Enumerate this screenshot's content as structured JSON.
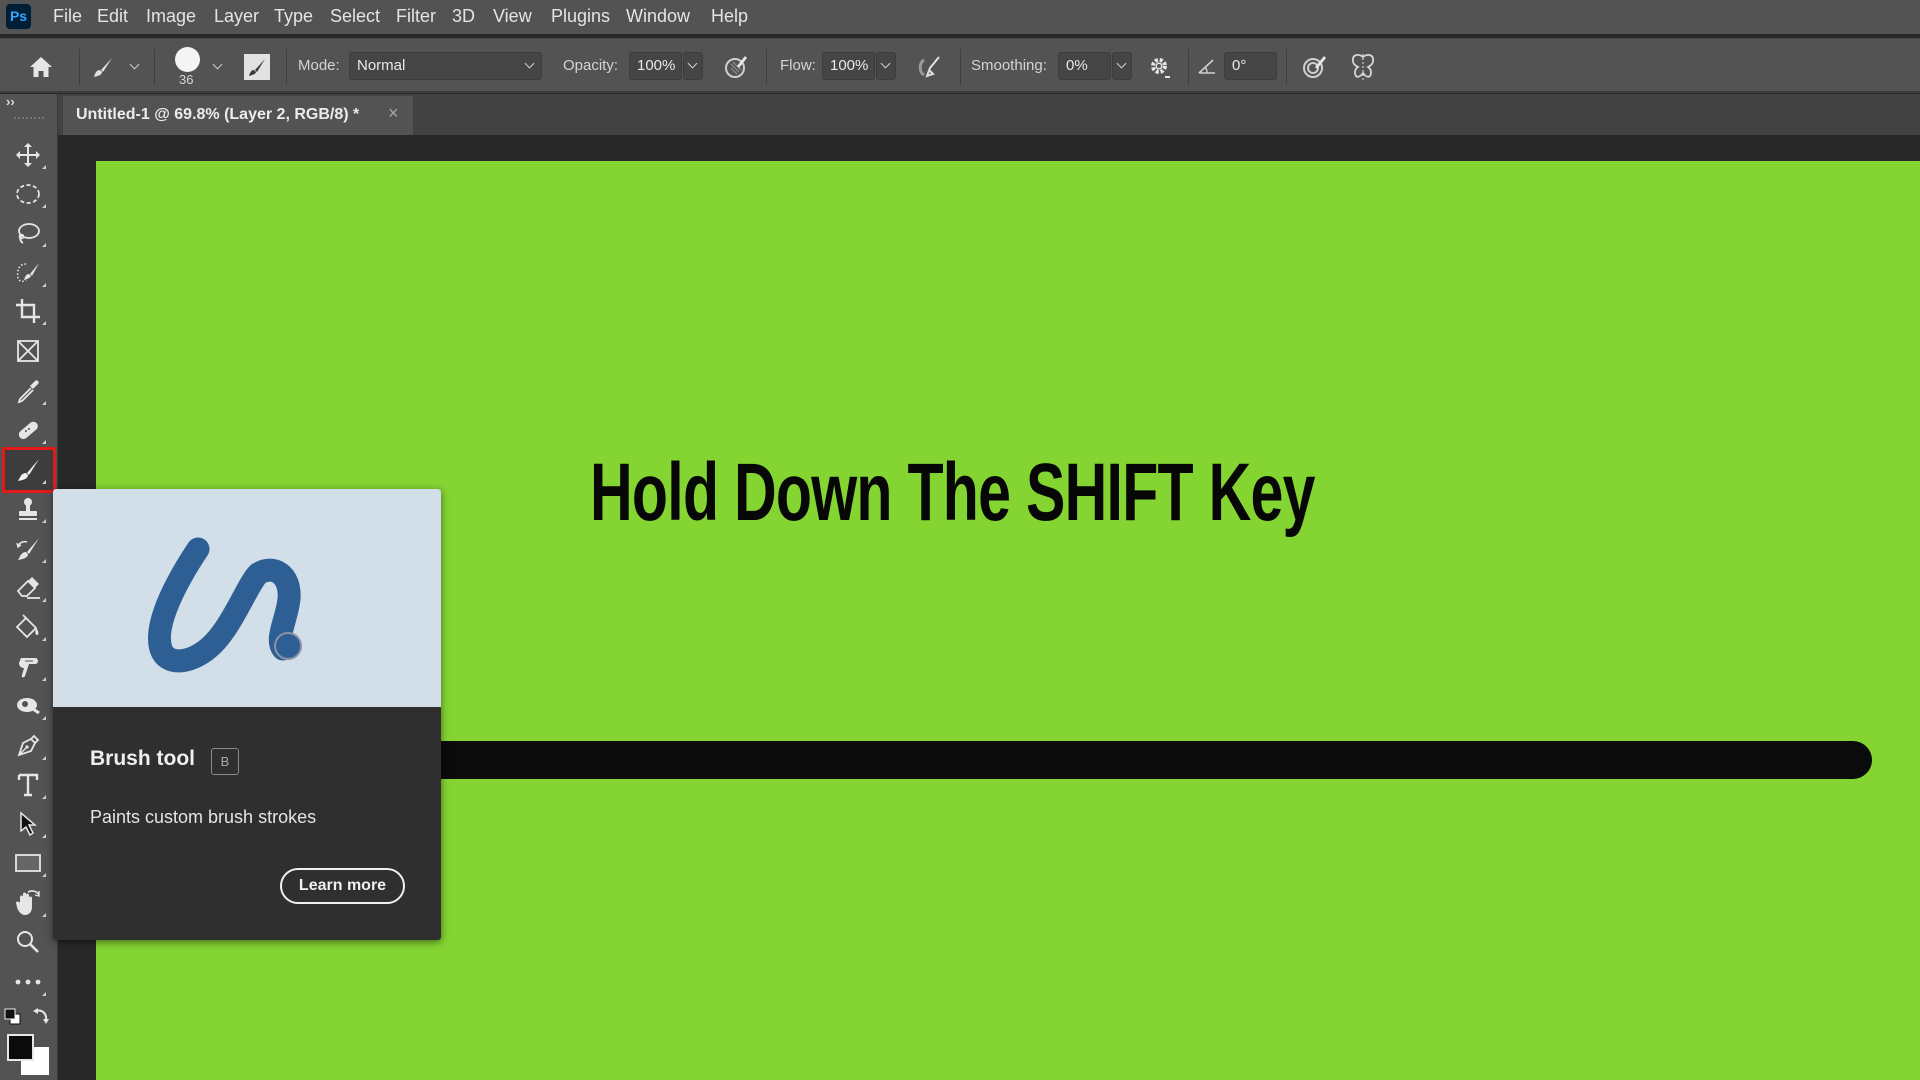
{
  "app": {
    "logo": "Ps",
    "menu": [
      "File",
      "Edit",
      "Image",
      "Layer",
      "Type",
      "Select",
      "Filter",
      "3D",
      "View",
      "Plugins",
      "Window",
      "Help"
    ]
  },
  "options_bar": {
    "brush_size": "36",
    "mode_label": "Mode:",
    "mode_value": "Normal",
    "opacity_label": "Opacity:",
    "opacity_value": "100%",
    "flow_label": "Flow:",
    "flow_value": "100%",
    "smoothing_label": "Smoothing:",
    "smoothing_value": "0%",
    "angle_value": "0°",
    "icons": [
      "home-icon",
      "brush-preset-icon",
      "brush-tip-icon",
      "brush-settings-panel-icon",
      "pressure-opacity-icon",
      "airbrush-icon",
      "smoothing-settings-icon",
      "angle-icon",
      "pressure-size-icon",
      "symmetry-icon"
    ]
  },
  "document_tab": {
    "title": "Untitled-1 @ 69.8% (Layer 2, RGB/8) *",
    "close": "×"
  },
  "toolbar": {
    "collapse": "››",
    "tools": [
      {
        "name": "move-tool",
        "icon": "move-icon"
      },
      {
        "name": "marquee-tool",
        "icon": "elliptical-marquee-icon"
      },
      {
        "name": "lasso-tool",
        "icon": "lasso-icon"
      },
      {
        "name": "quick-selection-tool",
        "icon": "quick-selection-icon"
      },
      {
        "name": "crop-tool",
        "icon": "crop-icon"
      },
      {
        "name": "frame-tool",
        "icon": "frame-icon"
      },
      {
        "name": "eyedropper-tool",
        "icon": "eyedropper-icon"
      },
      {
        "name": "healing-brush-tool",
        "icon": "bandage-icon"
      },
      {
        "name": "brush-tool",
        "icon": "brush-icon",
        "selected": true
      },
      {
        "name": "clone-stamp-tool",
        "icon": "stamp-icon"
      },
      {
        "name": "history-brush-tool",
        "icon": "history-brush-icon"
      },
      {
        "name": "eraser-tool",
        "icon": "eraser-icon"
      },
      {
        "name": "paint-bucket-tool",
        "icon": "paint-bucket-icon"
      },
      {
        "name": "smudge-tool",
        "icon": "smudge-icon"
      },
      {
        "name": "dodge-tool",
        "icon": "dodge-icon"
      },
      {
        "name": "pen-tool",
        "icon": "pen-icon"
      },
      {
        "name": "type-tool",
        "icon": "type-icon"
      },
      {
        "name": "path-selection-tool",
        "icon": "arrow-icon"
      },
      {
        "name": "rectangle-tool",
        "icon": "rectangle-icon"
      },
      {
        "name": "hand-tool",
        "icon": "hand-icon"
      },
      {
        "name": "zoom-tool",
        "icon": "magnifier-icon"
      },
      {
        "name": "more-tools",
        "icon": "ellipsis-icon"
      }
    ],
    "foreground_color": "#0b0b0b",
    "background_color": "#ffffff"
  },
  "canvas": {
    "background_color": "#84d432",
    "text": "Hold Down The SHIFT Key",
    "stroke_color": "#0b0b0b"
  },
  "tooltip": {
    "title": "Brush tool",
    "shortcut": "B",
    "description": "Paints custom brush strokes",
    "learn_more": "Learn more",
    "illustration_color": "#2e5f94"
  },
  "colors": {
    "ui_panel": "#535353",
    "highlight": "#e21a1a"
  }
}
